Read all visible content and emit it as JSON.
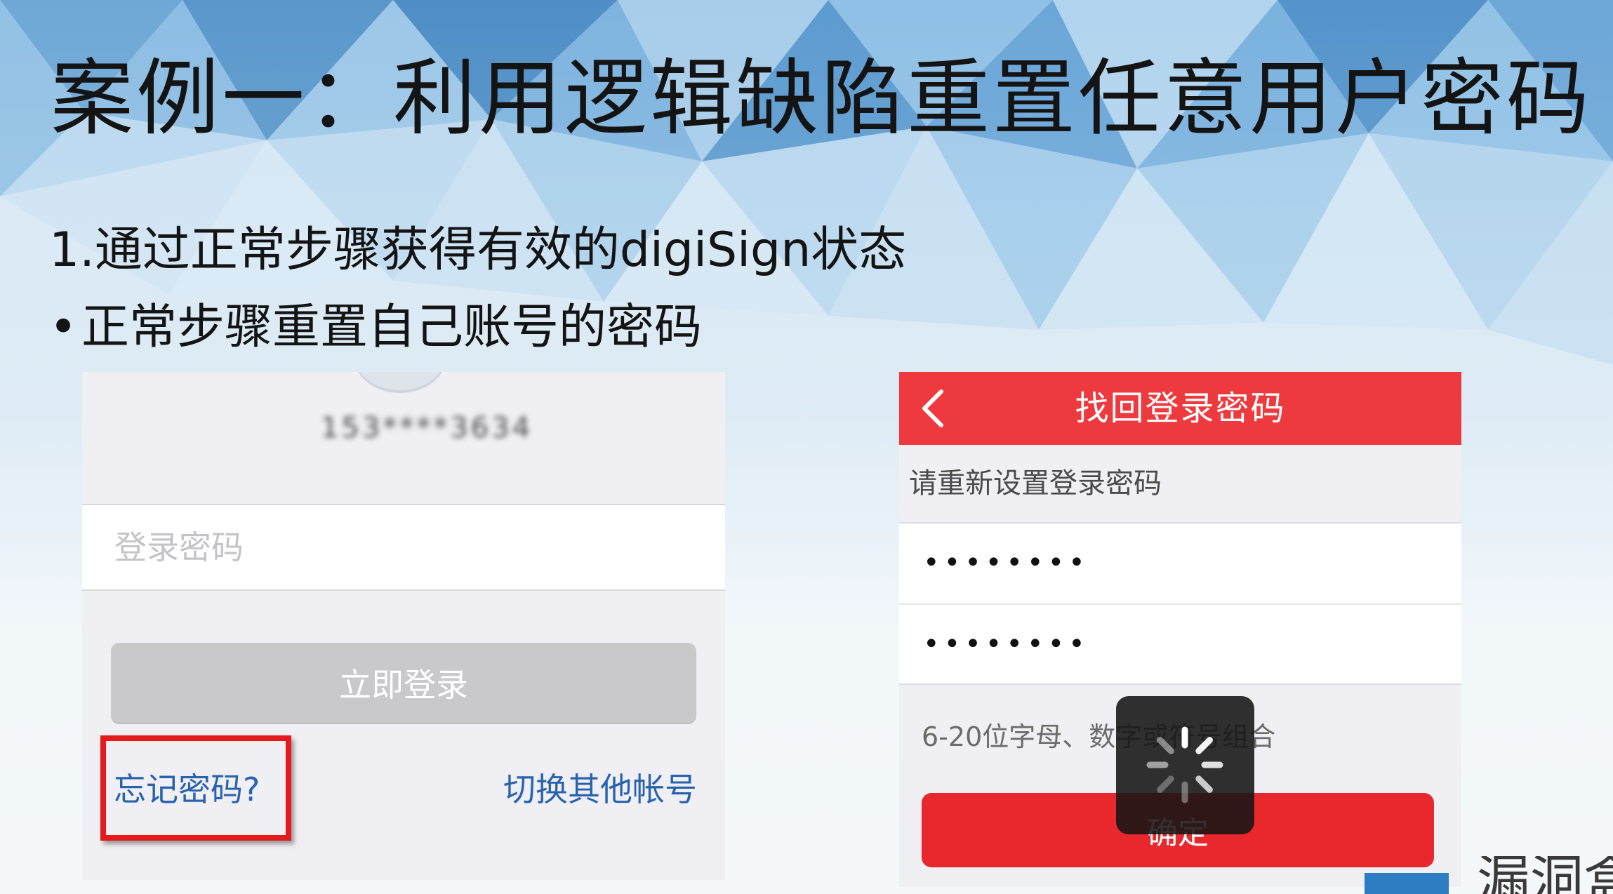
{
  "slide": {
    "title": "案例一：利用逻辑缺陷重置任意用户密码",
    "step": "1.通过正常步骤获得有效的digiSign状态",
    "bullet_marker": "•",
    "bullet": "正常步骤重置自己账号的密码"
  },
  "login_screen": {
    "masked_account": "153****3634",
    "password_placeholder": "登录密码",
    "login_button": "立即登录",
    "forgot_link": "忘记密码?",
    "switch_link": "切换其他帐号"
  },
  "reset_screen": {
    "nav_title": "找回登录密码",
    "back_icon": "chevron-left-icon",
    "section_label": "请重新设置登录密码",
    "password_1": "••••••••",
    "password_2": "••••••••",
    "hint": "6-20位字母、数字或符号组合",
    "confirm_button": "确定",
    "loading_icon": "spinner-icon"
  },
  "watermark": {
    "text": "漏洞盒"
  },
  "colors": {
    "nav_red": "#ee3a3e",
    "confirm_red": "#e8282c",
    "link_blue": "#2a63ad",
    "highlight_red": "#e51a1a",
    "disabled_gray": "#c9c9cb"
  }
}
